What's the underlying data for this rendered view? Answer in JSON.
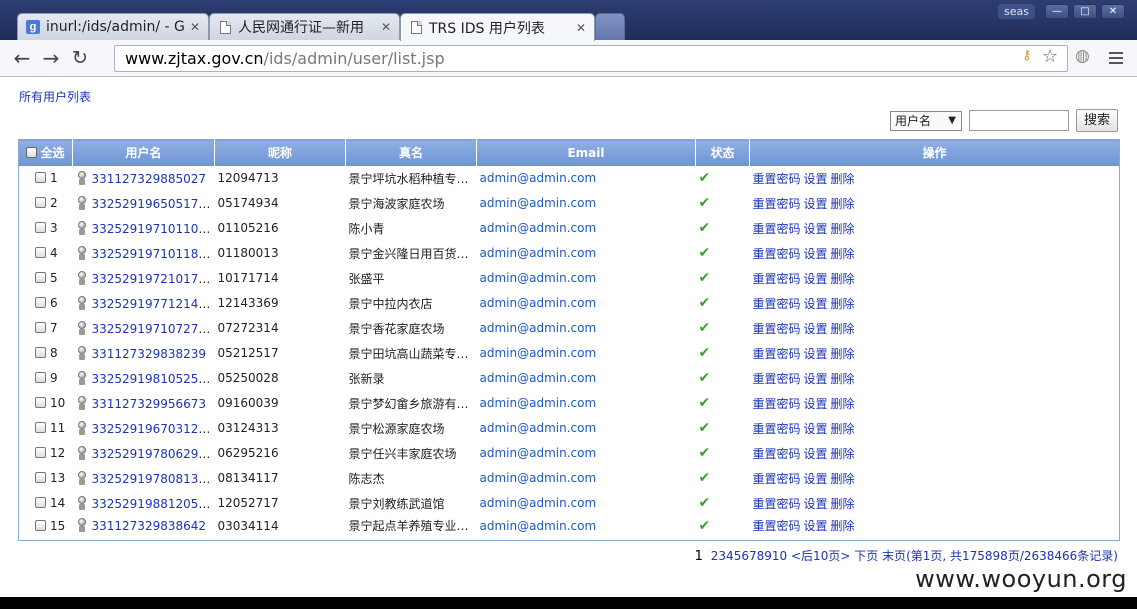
{
  "browser": {
    "tabs": [
      {
        "title": "inurl:/ids/admin/ - G",
        "icon": "google-g"
      },
      {
        "title": "人民网通行证—新用",
        "icon": "document"
      },
      {
        "title": "TRS IDS 用户列表",
        "icon": "document"
      }
    ],
    "user_label": "seas",
    "url_host": "www.zjtax.gov.cn",
    "url_path": "/ids/admin/user/list.jsp"
  },
  "page": {
    "breadcrumb": "所有用户列表",
    "search": {
      "field_selected": "用户名",
      "button_label": "搜索"
    },
    "table": {
      "columns": [
        "全选",
        "用户名",
        "昵称",
        "真名",
        "Email",
        "状态",
        "操作"
      ],
      "actions": [
        "重置密码",
        "设置",
        "删除"
      ],
      "rows": [
        {
          "no": "1",
          "username": "331127329885027",
          "nick": "12094713",
          "realname": "景宁坪坑水稻种植专…",
          "email": "admin@admin.com"
        },
        {
          "no": "2",
          "username": "332529196505174…",
          "nick": "05174934",
          "realname": "景宁海波家庭农场",
          "email": "admin@admin.com"
        },
        {
          "no": "3",
          "username": "332529197101105…",
          "nick": "01105216",
          "realname": "陈小青",
          "email": "admin@admin.com"
        },
        {
          "no": "4",
          "username": "332529197101180…",
          "nick": "01180013",
          "realname": "景宁金兴隆日用百货…",
          "email": "admin@admin.com"
        },
        {
          "no": "5",
          "username": "332529197210171…",
          "nick": "10171714",
          "realname": "张盛平",
          "email": "admin@admin.com"
        },
        {
          "no": "6",
          "username": "332529197712143…",
          "nick": "12143369",
          "realname": "景宁中拉内衣店",
          "email": "admin@admin.com"
        },
        {
          "no": "7",
          "username": "332529197107272…",
          "nick": "07272314",
          "realname": "景宁香花家庭农场",
          "email": "admin@admin.com"
        },
        {
          "no": "8",
          "username": "331127329838239",
          "nick": "05212517",
          "realname": "景宁田坑高山蔬菜专…",
          "email": "admin@admin.com"
        },
        {
          "no": "9",
          "username": "332529198105250…",
          "nick": "05250028",
          "realname": "张新录",
          "email": "admin@admin.com"
        },
        {
          "no": "10",
          "username": "331127329956673",
          "nick": "09160039",
          "realname": "景宁梦幻畲乡旅游有…",
          "email": "admin@admin.com"
        },
        {
          "no": "11",
          "username": "332529196703124…",
          "nick": "03124313",
          "realname": "景宁松源家庭农场",
          "email": "admin@admin.com"
        },
        {
          "no": "12",
          "username": "332529197806295…",
          "nick": "06295216",
          "realname": "景宁任兴丰家庭农场",
          "email": "admin@admin.com"
        },
        {
          "no": "13",
          "username": "332529197808134…",
          "nick": "08134117",
          "realname": "陈志杰",
          "email": "admin@admin.com"
        },
        {
          "no": "14",
          "username": "332529198812052…",
          "nick": "12052717",
          "realname": "景宁刘教练武道馆",
          "email": "admin@admin.com"
        },
        {
          "no": "15",
          "username": "331127329838642",
          "nick": "03034114",
          "realname": "景宁起点羊养殖专业…",
          "email": "admin@admin.com"
        }
      ]
    },
    "pager": {
      "current": "1",
      "pages": [
        "2",
        "3",
        "4",
        "5",
        "6",
        "7",
        "8",
        "9",
        "10"
      ],
      "next10": "<后10页>",
      "next": "下页",
      "last": "末页(第1页, 共175898页/2638466条记录)"
    }
  },
  "watermark": "www.wooyun.org",
  "colors": {
    "header_bg": "#7a9ddb",
    "link": "#1d33b8",
    "status_ok": "#3aa22b"
  }
}
